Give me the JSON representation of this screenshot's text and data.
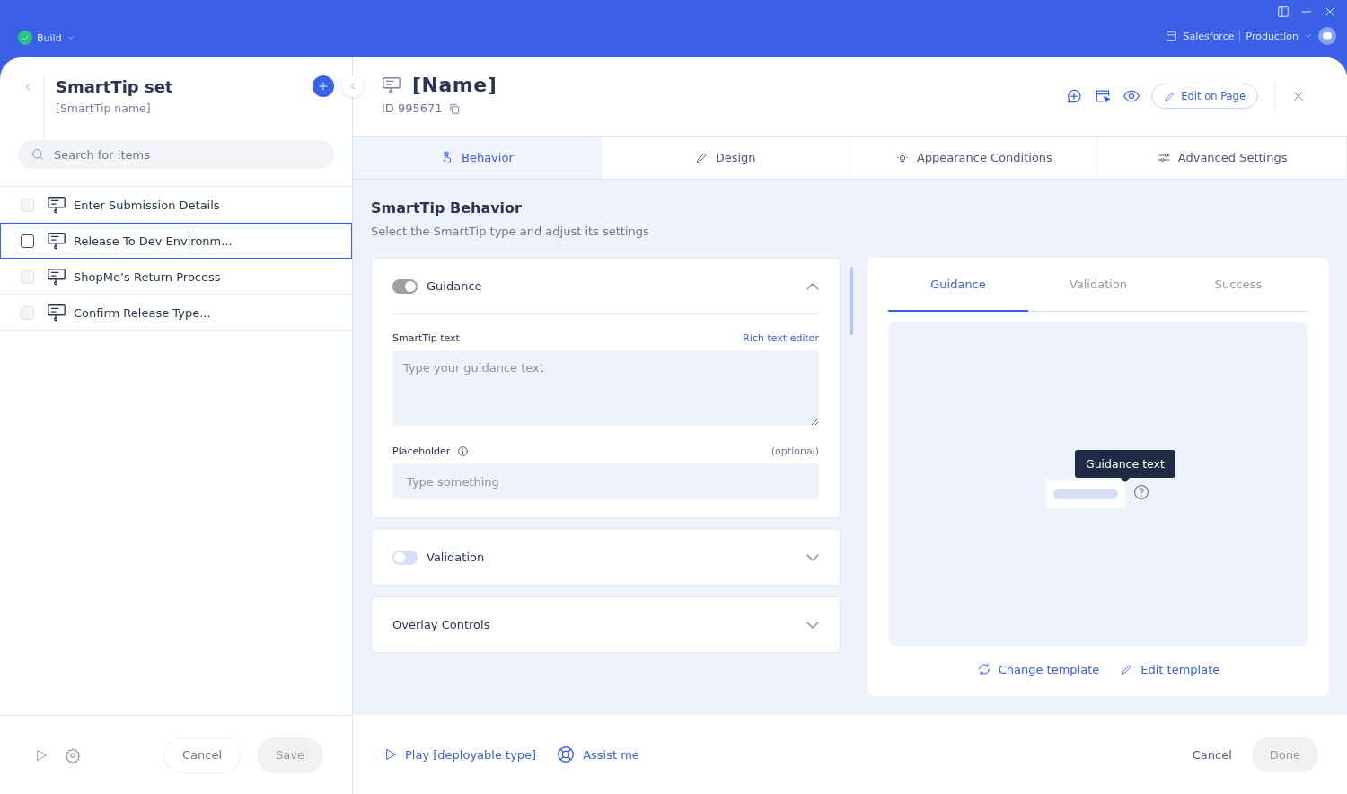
{
  "top_bar": {
    "status": "Build",
    "environment": "Salesforce",
    "instance": "Production"
  },
  "sidebar": {
    "title": "SmartTip set",
    "subtitle": "[SmartTip name]",
    "search": {
      "placeholder": "Search for items"
    },
    "items": [
      {
        "label": "Enter Submission Details",
        "selected": false
      },
      {
        "label": "Release To Dev Environm...",
        "selected": true
      },
      {
        "label": "ShopMe’s Return Process",
        "selected": false
      },
      {
        "label": "Confirm Release Type...",
        "selected": false
      }
    ],
    "buttons": [
      {
        "label": "Cancel",
        "disabled": false
      },
      {
        "label": "Save",
        "disabled": true
      }
    ]
  },
  "editor": {
    "name": "[Name]",
    "id": "ID 995671",
    "edit_button": "Edit on Page",
    "tabs": [
      {
        "label": "Behavior",
        "selected": true,
        "kind": "hand"
      },
      {
        "label": "Design",
        "selected": false,
        "kind": "pencil"
      },
      {
        "label": "Appearance Conditions",
        "selected": false,
        "kind": "bulb"
      },
      {
        "label": "Advanced Settings",
        "selected": false,
        "kind": "sliders"
      }
    ],
    "section_title": "SmartTip Behavior",
    "section_subtitle": "Select the SmartTip type and adjust its settings",
    "panels": [
      {
        "kind": "toggle",
        "label": "Guidance",
        "on": true,
        "expanded": true,
        "text_label": "SmartTip text",
        "rich_text_link": "Rich text editor",
        "text_placeholder": "Type your guidance text",
        "placeholder_label": "Placeholder",
        "optional": "(optional)",
        "placeholder_field": "Type something"
      },
      {
        "kind": "toggle",
        "label": "Validation",
        "on": false,
        "expanded": false
      },
      {
        "kind": "plain",
        "label": "Overlay Controls",
        "expanded": false
      }
    ],
    "preview": {
      "tabs": [
        {
          "label": "Guidance",
          "selected": true
        },
        {
          "label": "Validation",
          "selected": false
        },
        {
          "label": "Success",
          "selected": false
        }
      ],
      "tooltip": "Guidance text",
      "actions": [
        {
          "label": "Change template",
          "kind": "refresh"
        },
        {
          "label": "Edit template",
          "kind": "pencil"
        }
      ]
    }
  },
  "footer": {
    "play": "Play [deployable type]",
    "assist": "Assist me",
    "buttons": [
      {
        "label": "Cancel",
        "disabled": false
      },
      {
        "label": "Done",
        "disabled": true
      }
    ]
  }
}
